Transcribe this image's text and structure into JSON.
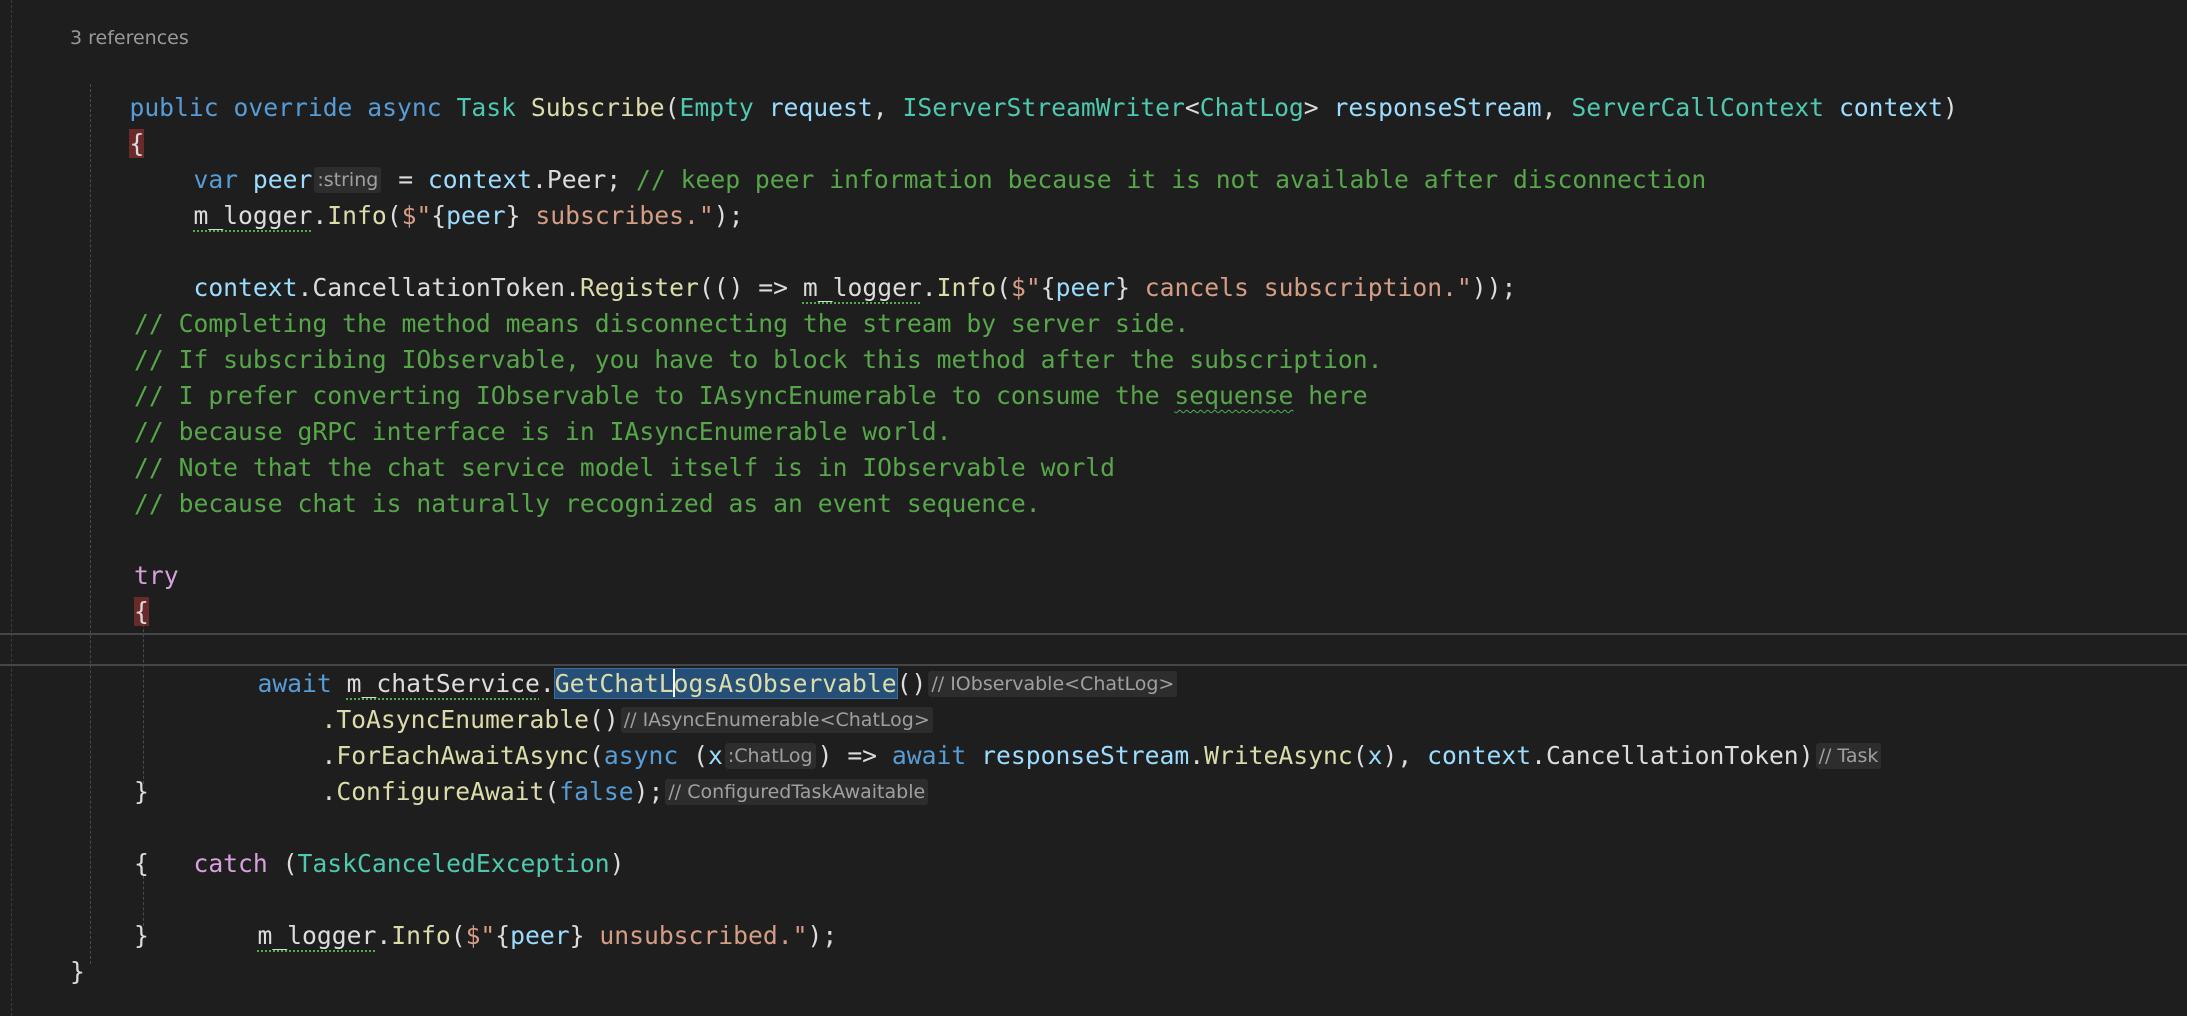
{
  "codelens": "3 references",
  "code": {
    "l1": {
      "public": "public",
      "override": "override",
      "async": "async",
      "task": "Task",
      "subscribe": "Subscribe",
      "open": "(",
      "empty": "Empty",
      "request": "request",
      "comma1": ", ",
      "writer": "IServerStreamWriter",
      "lt": "<",
      "chatlog": "ChatLog",
      "gt": ">",
      "responseStream": "responseStream",
      "comma2": ", ",
      "ctxType": "ServerCallContext",
      "context": "context",
      "close": ")"
    },
    "l2": {
      "brace": "{"
    },
    "l3": {
      "var": "var",
      "peer": "peer",
      "hint": ":string",
      "eq": " = ",
      "context": "context",
      "dot": ".",
      "peerProp": "Peer",
      "semi": "; ",
      "comment": "// keep peer information because it is not available after disconnection"
    },
    "l4": {
      "logger": "m_logger",
      "dot": ".",
      "info": "Info",
      "open": "(",
      "str1": "$\"",
      "lb": "{",
      "peer": "peer",
      "rb": "}",
      "str2": " subscribes.\"",
      "close": ");"
    },
    "l5": {
      "context": "context",
      "dot1": ".",
      "token": "CancellationToken",
      "dot2": ".",
      "register": "Register",
      "lambda": "(() => ",
      "logger": "m_logger",
      "dot3": ".",
      "info": "Info",
      "open": "(",
      "str1": "$\"",
      "lb": "{",
      "peer": "peer",
      "rb": "}",
      "str2": " cancels subscription.\"",
      "close": "));"
    },
    "comments": [
      "// Completing the method means disconnecting the stream by server side.",
      "// If subscribing IObservable, you have to block this method after the subscription.",
      "// I prefer converting IObservable to IAsyncEnumerable to consume the ",
      "// because gRPC interface is in IAsyncEnumerable world.",
      "// Note that the chat service model itself is in IObservable world",
      "// because chat is naturally recognized as an event sequence."
    ],
    "c3_word": "sequense",
    "c3_tail": " here",
    "try": "try",
    "try_open": "{",
    "l_await": {
      "await": "await",
      "svc": "m_chatService",
      "dot": ".",
      "method_a": "GetChatL",
      "method_b": "ogsAsObservable",
      "parens": "()",
      "hint": "// IObservable<ChatLog>"
    },
    "l_toasync": {
      "call": ".ToAsyncEnumerable",
      "parens": "()",
      "hint": "// IAsyncEnumerable<ChatLog>"
    },
    "l_foreach": {
      "dot": ".",
      "method": "ForEachAwaitAsync",
      "open": "(",
      "async": "async",
      "sp": " ",
      "lp": "(",
      "x": "x",
      "hint": ":ChatLog",
      "rp": ") => ",
      "await": "await",
      "sp2": " ",
      "rs": "responseStream",
      "dot2": ".",
      "write": "WriteAsync",
      "open2": "(",
      "x2": "x",
      "comma": "), ",
      "context": "context",
      "dot3": ".",
      "token": "CancellationToken",
      "close": ")",
      "hint2": "// Task"
    },
    "l_config": {
      "dot": ".",
      "method": "ConfigureAwait",
      "open": "(",
      "false": "false",
      "close": ");",
      "hint": "// ConfiguredTaskAwaitable"
    },
    "try_close": "}",
    "catch": "catch",
    "catch_open": " (",
    "exc": "TaskCanceledException",
    "catch_close": ")",
    "catch_brace_open": "{",
    "l_unsub": {
      "logger": "m_logger",
      "dot": ".",
      "info": "Info",
      "open": "(",
      "str1": "$\"",
      "lb": "{",
      "peer": "peer",
      "rb": "}",
      "str2": " unsubscribed.\"",
      "close": ");"
    },
    "catch_brace_close": "}",
    "method_close": "}"
  },
  "colors": {
    "background": "#1e1e1e",
    "keyword": "#569cd6",
    "control": "#d8a0df",
    "type": "#4ec9b0",
    "method": "#dcdcaa",
    "variable": "#9cdcfe",
    "string": "#d69d85",
    "comment": "#57a64a",
    "selection": "#264f78"
  }
}
